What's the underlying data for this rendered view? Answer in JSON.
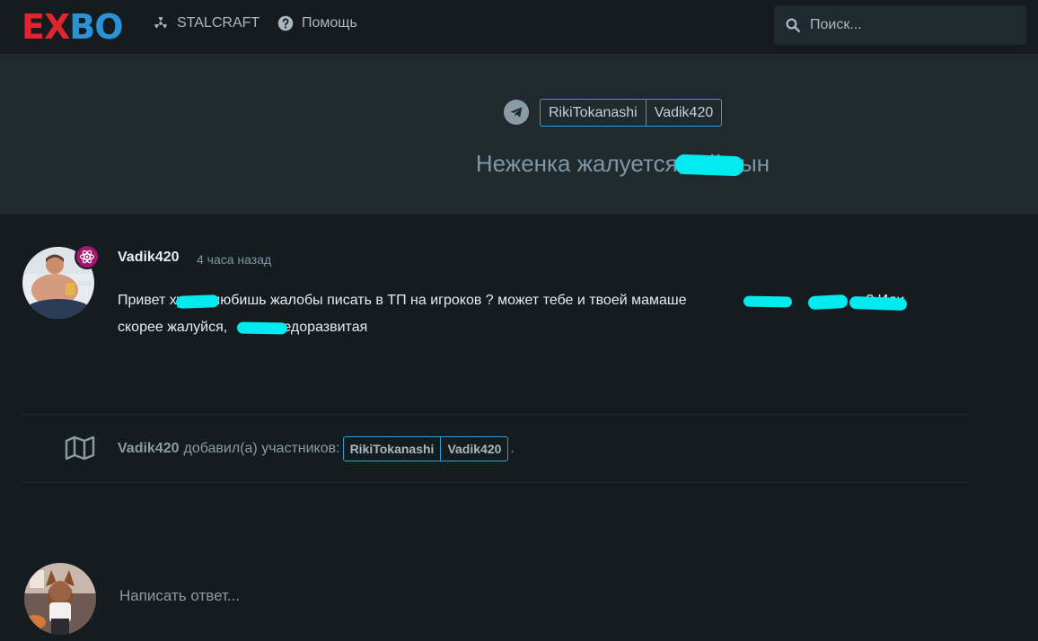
{
  "header": {
    "logo_left": "EX",
    "logo_right": "BO",
    "nav": [
      {
        "label": "STALCRAFT",
        "icon": "radiation-icon"
      },
      {
        "label": "Помощь",
        "icon": "help-circle-icon"
      }
    ],
    "search_placeholder": "Поиск..."
  },
  "discussion": {
    "tags": [
      "RikiTokanashi",
      "Vadik420"
    ],
    "title": "Неженка жалуется, с      й сын"
  },
  "post": {
    "author": "Vadik420",
    "time": "4 часа назад",
    "body_line1": "Привет ху     , любишь жалобы писать в ТП на игроков ? может тебе и твоей мамаше                   в                        ? Иди",
    "body_line2": "скорее жалуйся,            недоразвитая"
  },
  "event": {
    "user": "Vadik420",
    "action": "добавил(а) участников:",
    "tags": [
      "RikiTokanashi",
      "Vadik420"
    ],
    "trailing": "."
  },
  "reply": {
    "placeholder": "Написать ответ..."
  },
  "colors": {
    "accent": "#2aa0d6",
    "logo_red": "#e02430",
    "logo_blue": "#2a93d8",
    "censor": "#00eaf0"
  }
}
